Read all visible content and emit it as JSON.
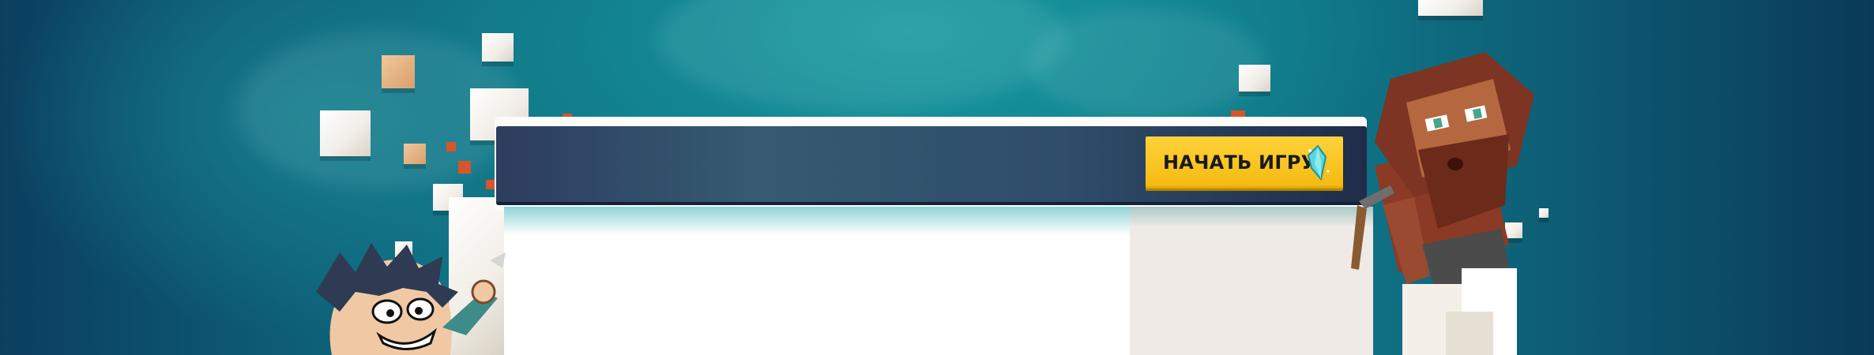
{
  "header": {
    "start_button_label": "НАЧАТЬ ИГРУ",
    "start_button_icon": "crystal-icon"
  },
  "colors": {
    "accent": "#f4b90f",
    "header_bar": "#2f4d69",
    "background": "#128a94"
  },
  "decorations": {
    "left_character": "cartoon-boy-character",
    "right_character": "bearded-blocky-miner-character"
  }
}
